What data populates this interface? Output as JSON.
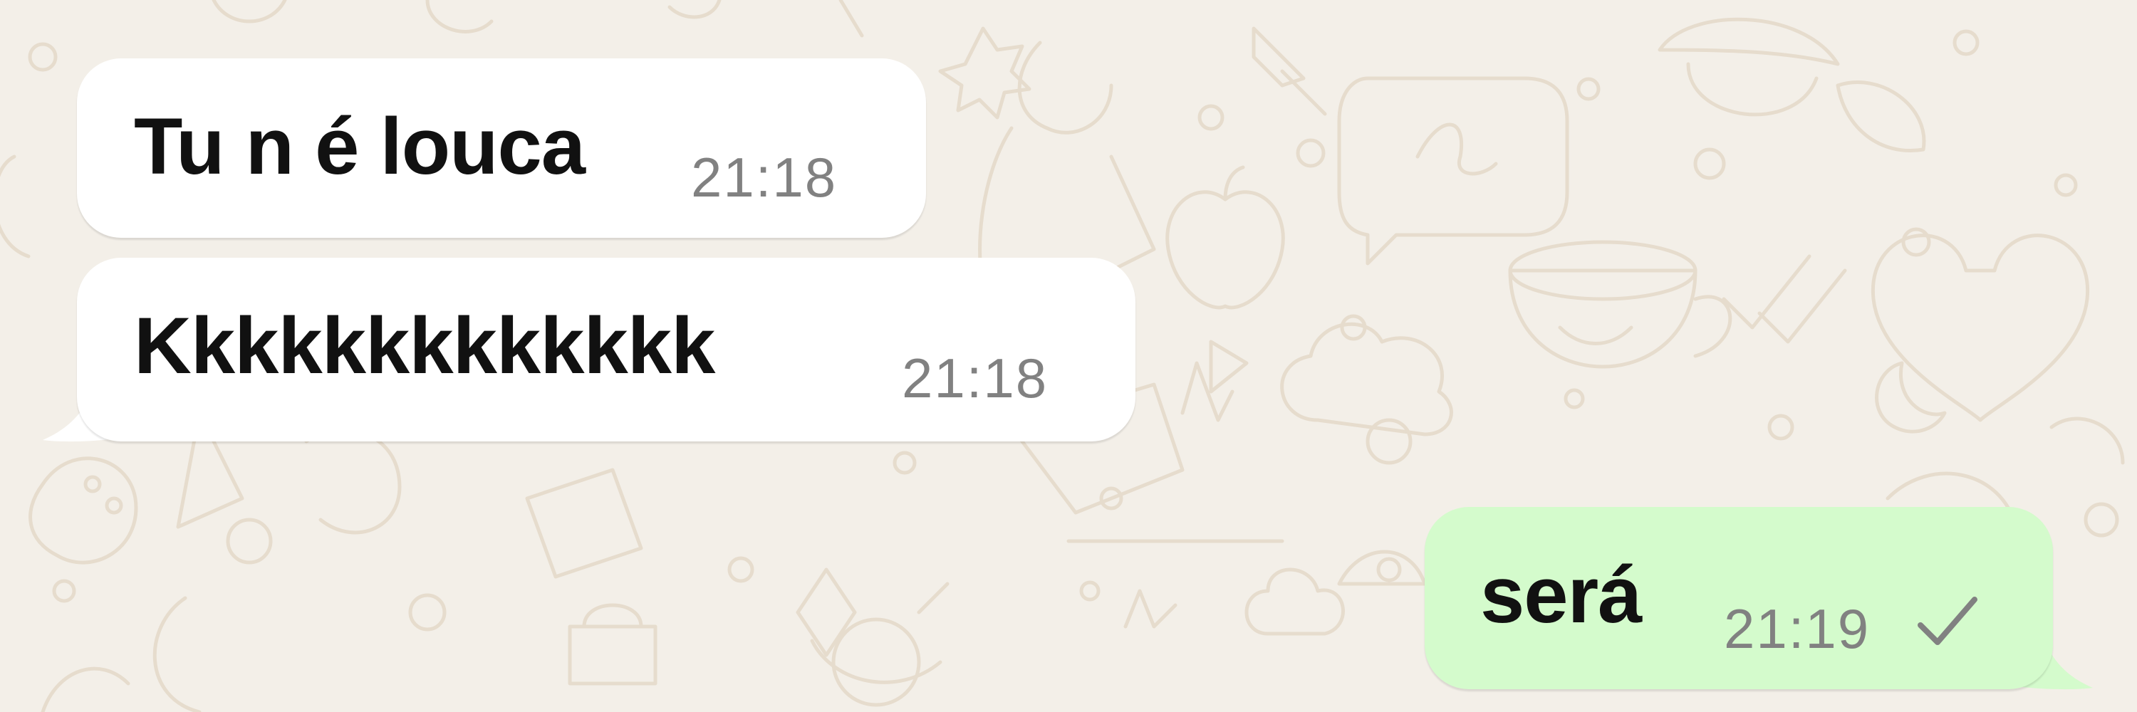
{
  "chat": {
    "background_color": "#f3efe8",
    "messages": [
      {
        "direction": "incoming",
        "text": "Tu n é louca",
        "time": "21:18"
      },
      {
        "direction": "incoming",
        "text": "Kkkkkkkkkkkkk",
        "time": "21:18"
      },
      {
        "direction": "outgoing",
        "text": "será",
        "time": "21:19",
        "status_icon": "single-check-icon",
        "status": "sent"
      }
    ]
  },
  "colors": {
    "incoming_bubble": "#ffffff",
    "outgoing_bubble": "#d4fbcc",
    "message_text": "#111111",
    "timestamp": "#818181",
    "doodle_stroke": "#e6dccd"
  }
}
